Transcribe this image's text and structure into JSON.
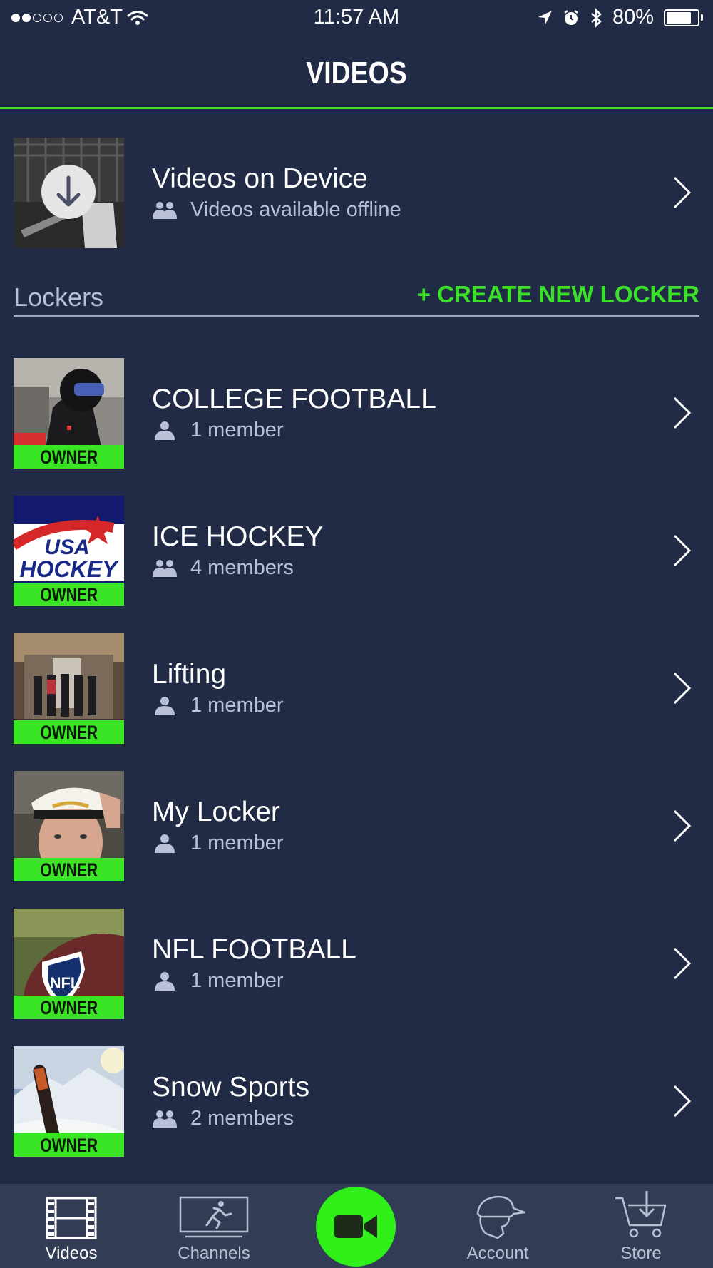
{
  "status_bar": {
    "carrier": "AT&T",
    "time": "11:57 AM",
    "battery": "80%",
    "signal_dots_filled": 2,
    "signal_dots_total": 5,
    "battery_level": 0.8
  },
  "header": {
    "title": "VIDEOS"
  },
  "device_videos": {
    "title": "Videos on Device",
    "subtitle": "Videos available offline"
  },
  "lockers": {
    "label": "Lockers",
    "create_label": "+ CREATE NEW LOCKER",
    "items": [
      {
        "title": "COLLEGE FOOTBALL",
        "members": "1 member",
        "badge": "OWNER",
        "icon": "single-member-icon"
      },
      {
        "title": "ICE HOCKEY",
        "members": "4 members",
        "badge": "OWNER",
        "icon": "group-members-icon",
        "thumb_text_1": "USA",
        "thumb_text_2": "HOCKEY"
      },
      {
        "title": "Lifting",
        "members": "1 member",
        "badge": "OWNER",
        "icon": "single-member-icon"
      },
      {
        "title": "My Locker",
        "members": "1 member",
        "badge": "OWNER",
        "icon": "single-member-icon"
      },
      {
        "title": "NFL FOOTBALL",
        "members": "1 member",
        "badge": "OWNER",
        "icon": "single-member-icon",
        "thumb_text_1": "NFL"
      },
      {
        "title": "Snow Sports",
        "members": "2 members",
        "badge": "OWNER",
        "icon": "group-members-icon"
      }
    ]
  },
  "tabbar": {
    "videos": "Videos",
    "channels": "Channels",
    "account": "Account",
    "store": "Store"
  },
  "colors": {
    "background": "#222b45",
    "accent_green": "#3ae128",
    "tabbar": "#333c55"
  }
}
